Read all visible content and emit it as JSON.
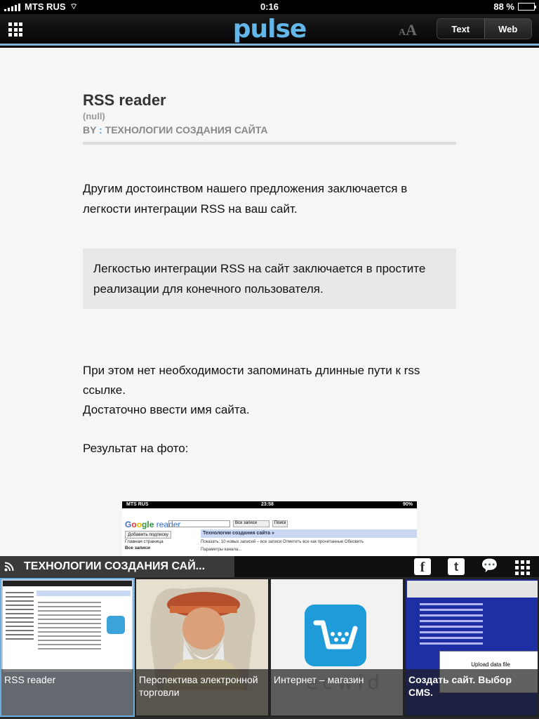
{
  "status_bar": {
    "carrier": "MTS RUS",
    "time": "0:16",
    "battery": "88 %",
    "battery_level": 0.88
  },
  "toolbar": {
    "logo": "pulse",
    "text_size_label_small": "A",
    "text_size_label_large": "A",
    "view_modes": [
      "Text",
      "Web"
    ],
    "active_view_mode": "Text"
  },
  "article": {
    "title": "RSS reader",
    "subtitle": "(null)",
    "byline_prefix": "BY",
    "byline_colon": ":",
    "byline_source": "ТЕХНОЛОГИИ СОЗДАНИЯ САЙТА",
    "paragraph_1": "Другим достоинством нашего предложения заключается в легкости интеграции RSS на ваш сайт.",
    "quote": "Легкостью интеграции RSS на сайт заключается в простите реализации для конечного пользователя.",
    "paragraph_2_line_1": "При этом нет необходимости запоминать длинные пути к rss ссылке.",
    "paragraph_2_line_2": "Достаточно ввести имя сайта.",
    "paragraph_3": "Результат на фото:"
  },
  "embedded_photo": {
    "carrier": "MTS RUS",
    "time": "23:58",
    "battery": "90%",
    "reader_logo_g": "G",
    "reader_logo_o1": "o",
    "reader_logo_o2": "o",
    "reader_logo_rest": "gle",
    "reader_logo_word": "reader",
    "select_label": "Все записи",
    "search_button": "Поиск",
    "feed_bar": "Технологии создания сайта »",
    "add_subscription": "Добавить подписку",
    "side_items": [
      "Главная страница",
      "Все записи"
    ],
    "row_1": "Показать: 10 новых записей – все записи  Отметить все как прочитанные  Обновить",
    "row_2": "Параметры канала..."
  },
  "overlay": {
    "source_name": "ТЕХНОЛОГИИ СОЗДАНИЯ САЙ...",
    "facebook_glyph": "f",
    "twitter_glyph": "t",
    "comment_glyph": "💬"
  },
  "thumbnails": [
    {
      "caption": "RSS reader",
      "selected": true
    },
    {
      "caption": "Перспектива электронной торговли",
      "selected": false
    },
    {
      "caption": "Интернет – магазин",
      "selected": false
    },
    {
      "caption": "Создать сайт. Выбор CMS.",
      "selected": false
    }
  ],
  "thumb_extra": {
    "ecwid_word": "ecwid",
    "upload_dialog": "Upload data file"
  },
  "colors": {
    "accent": "#62b7e8",
    "selected_border": "#6aaee0",
    "article_bg": "#f6f6f6",
    "quote_bg": "#e8e8e8"
  }
}
